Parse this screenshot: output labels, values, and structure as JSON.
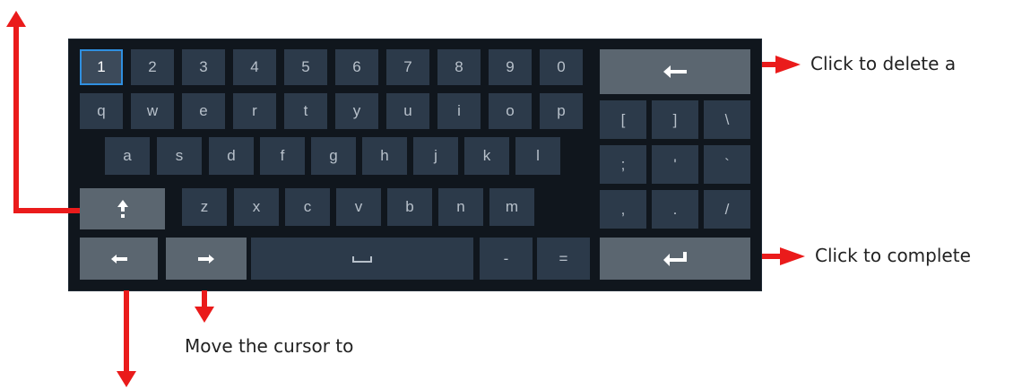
{
  "keyboard": {
    "row1": [
      "1",
      "2",
      "3",
      "4",
      "5",
      "6",
      "7",
      "8",
      "9",
      "0"
    ],
    "row2": [
      "q",
      "w",
      "e",
      "r",
      "t",
      "y",
      "u",
      "i",
      "o",
      "p"
    ],
    "row3": [
      "a",
      "s",
      "d",
      "f",
      "g",
      "h",
      "j",
      "k",
      "l"
    ],
    "row4": [
      "z",
      "x",
      "c",
      "v",
      "b",
      "n",
      "m"
    ],
    "row5": [
      "-",
      "="
    ],
    "right_row2": [
      "[",
      "]",
      "\\"
    ],
    "right_row3": [
      ";",
      "'",
      "`"
    ],
    "right_row4": [
      ",",
      ".",
      "/"
    ]
  },
  "annotations": {
    "delete": "Click to delete a",
    "complete": "Click to complete",
    "cursor": "Move the cursor to"
  },
  "colors": {
    "keyboard_bg": "#10161d",
    "key": "#2c3a4a",
    "key_light": "#5b6670",
    "selected_border": "#2f8fe0",
    "arrow": "#ea1b1b"
  },
  "icons": {
    "backspace": "left-arrow-icon",
    "enter": "enter-icon",
    "shift": "shift-icon",
    "space": "space-icon",
    "cursor_left": "left-arrow-icon",
    "cursor_right": "right-arrow-icon"
  }
}
